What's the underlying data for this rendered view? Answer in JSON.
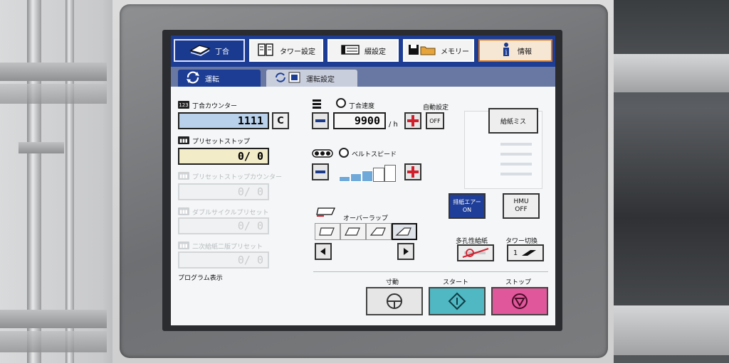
{
  "header_tabs": [
    {
      "label": "丁合",
      "icon": "booklet-icon",
      "active": true
    },
    {
      "label": "タワー設定",
      "icon": "tower-icon",
      "active": false
    },
    {
      "label": "綴設定",
      "icon": "binding-icon",
      "active": false
    },
    {
      "label": "メモリー",
      "icon": "memory-folder-icon",
      "active": false
    },
    {
      "label": "情報",
      "icon": "info-icon",
      "active": false
    }
  ],
  "sub_tabs": [
    {
      "label": "運転",
      "active": true
    },
    {
      "label": "運転設定",
      "active": false
    }
  ],
  "left_panel": {
    "counter_badge": "123",
    "counter_label": "丁合カウンター",
    "counter_value": "1111",
    "clear_button": "C",
    "preset_label": "プリセットストップ",
    "preset_value": "0/      0",
    "preset_counter_label": "プリセットストップカウンター",
    "preset_counter_value": "0/      0",
    "double_cycle_label": "ダブルサイクルプリセット",
    "double_cycle_value": "0/      0",
    "feed_preset_label": "二次給紙二版プリセット",
    "feed_preset_value": "0/      0",
    "program_label": "プログラム表示"
  },
  "speed": {
    "collate_speed_label": "丁合速度",
    "collate_speed_value": "9900",
    "unit": "/ h",
    "auto_setting_label": "自動設定",
    "auto_setting_value": "OFF",
    "belt_speed_label": "ベルトスピード",
    "belt_speed_level": 0.6
  },
  "overlap": {
    "label": "オーバーラップ",
    "options": [
      "overlap-1",
      "overlap-2",
      "overlap-3",
      "overlap-4"
    ],
    "selected_index": 3
  },
  "right_panel": {
    "misfeed_button": "給紙ミス",
    "air_button_line1": "排紙エアー",
    "air_button_line2": "ON",
    "hmu_button_line1": "HMU",
    "hmu_button_line2": "OFF",
    "multi_sheet_label": "多孔性給紙",
    "tower_switch_label": "タワー切換",
    "tower_switch_num": "1"
  },
  "controls": {
    "jog_label": "寸動",
    "start_label": "スタート",
    "stop_label": "ストップ"
  },
  "colors": {
    "header_blue": "#1c3d93",
    "start_teal": "#4fb8c3",
    "stop_pink": "#e0579b",
    "active_air_blue": "#1f3e99"
  }
}
